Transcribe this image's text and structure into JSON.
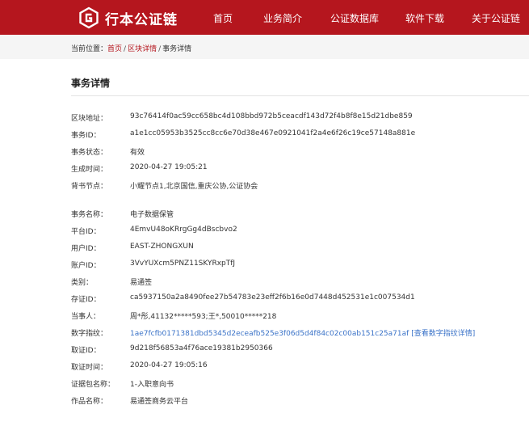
{
  "header": {
    "logo_text": "行本公证链",
    "nav": [
      "首页",
      "业务简介",
      "公证数据库",
      "软件下载",
      "关于公证链"
    ],
    "brand_color": "#b5161e",
    "icon": "logo-mark-icon"
  },
  "breadcrumb": {
    "prefix": "当前位置：",
    "home": "首页",
    "sep": "/",
    "block": "区块详情",
    "current": "事务详情"
  },
  "page_title": "事务详情",
  "details_top": [
    {
      "label": "区块地址：",
      "value": "93c76414f0ac59cc658bc4d108bbd972b5ceacdf143d72f4b8f8e15d21dbe859"
    },
    {
      "label": "事务ID：",
      "value": "a1e1cc05953b3525cc8cc6e70d38e467e0921041f2a4e6f26c19ce57148a881e"
    },
    {
      "label": "事务状态：",
      "value": "有效"
    },
    {
      "label": "生成时间：",
      "value": "2020-04-27 19:05:21"
    },
    {
      "label": "背书节点：",
      "value": "小耀节点1,北京国信,重庆公协,公证协会"
    }
  ],
  "details_bottom": [
    {
      "label": "事务名称：",
      "value": "电子数据保管"
    },
    {
      "label": "平台ID：",
      "value": "4EmvU48oKRrgGg4dBscbvo2"
    },
    {
      "label": "用户ID：",
      "value": "EAST-ZHONGXUN"
    },
    {
      "label": "账户ID：",
      "value": "3VvYUXcm5PNZ11SKYRxpTfJ"
    },
    {
      "label": "类别：",
      "value": "易通签"
    },
    {
      "label": "存证ID：",
      "value": "ca5937150a2a8490fee27b54783e23eff2f6b16e0d7448d452531e1c007534d1"
    },
    {
      "label": "当事人：",
      "value": "周*彤,41132*****593;王*,50010*****218"
    },
    {
      "label": "数字指纹：",
      "value": "1ae7fcfb0171381dbd5345d2eceafb525e3f06d5d4f84c02c00ab151c25a71af",
      "link_text": "[查看数字指纹详情]"
    },
    {
      "label": "取证ID：",
      "value": "9d218f56853a4f76ace19381b2950366"
    },
    {
      "label": "取证时间：",
      "value": "2020-04-27 19:05:16"
    },
    {
      "label": "证据包名称：",
      "value": "1-入职意向书"
    },
    {
      "label": "作品名称：",
      "value": "易通签商务云平台"
    }
  ]
}
